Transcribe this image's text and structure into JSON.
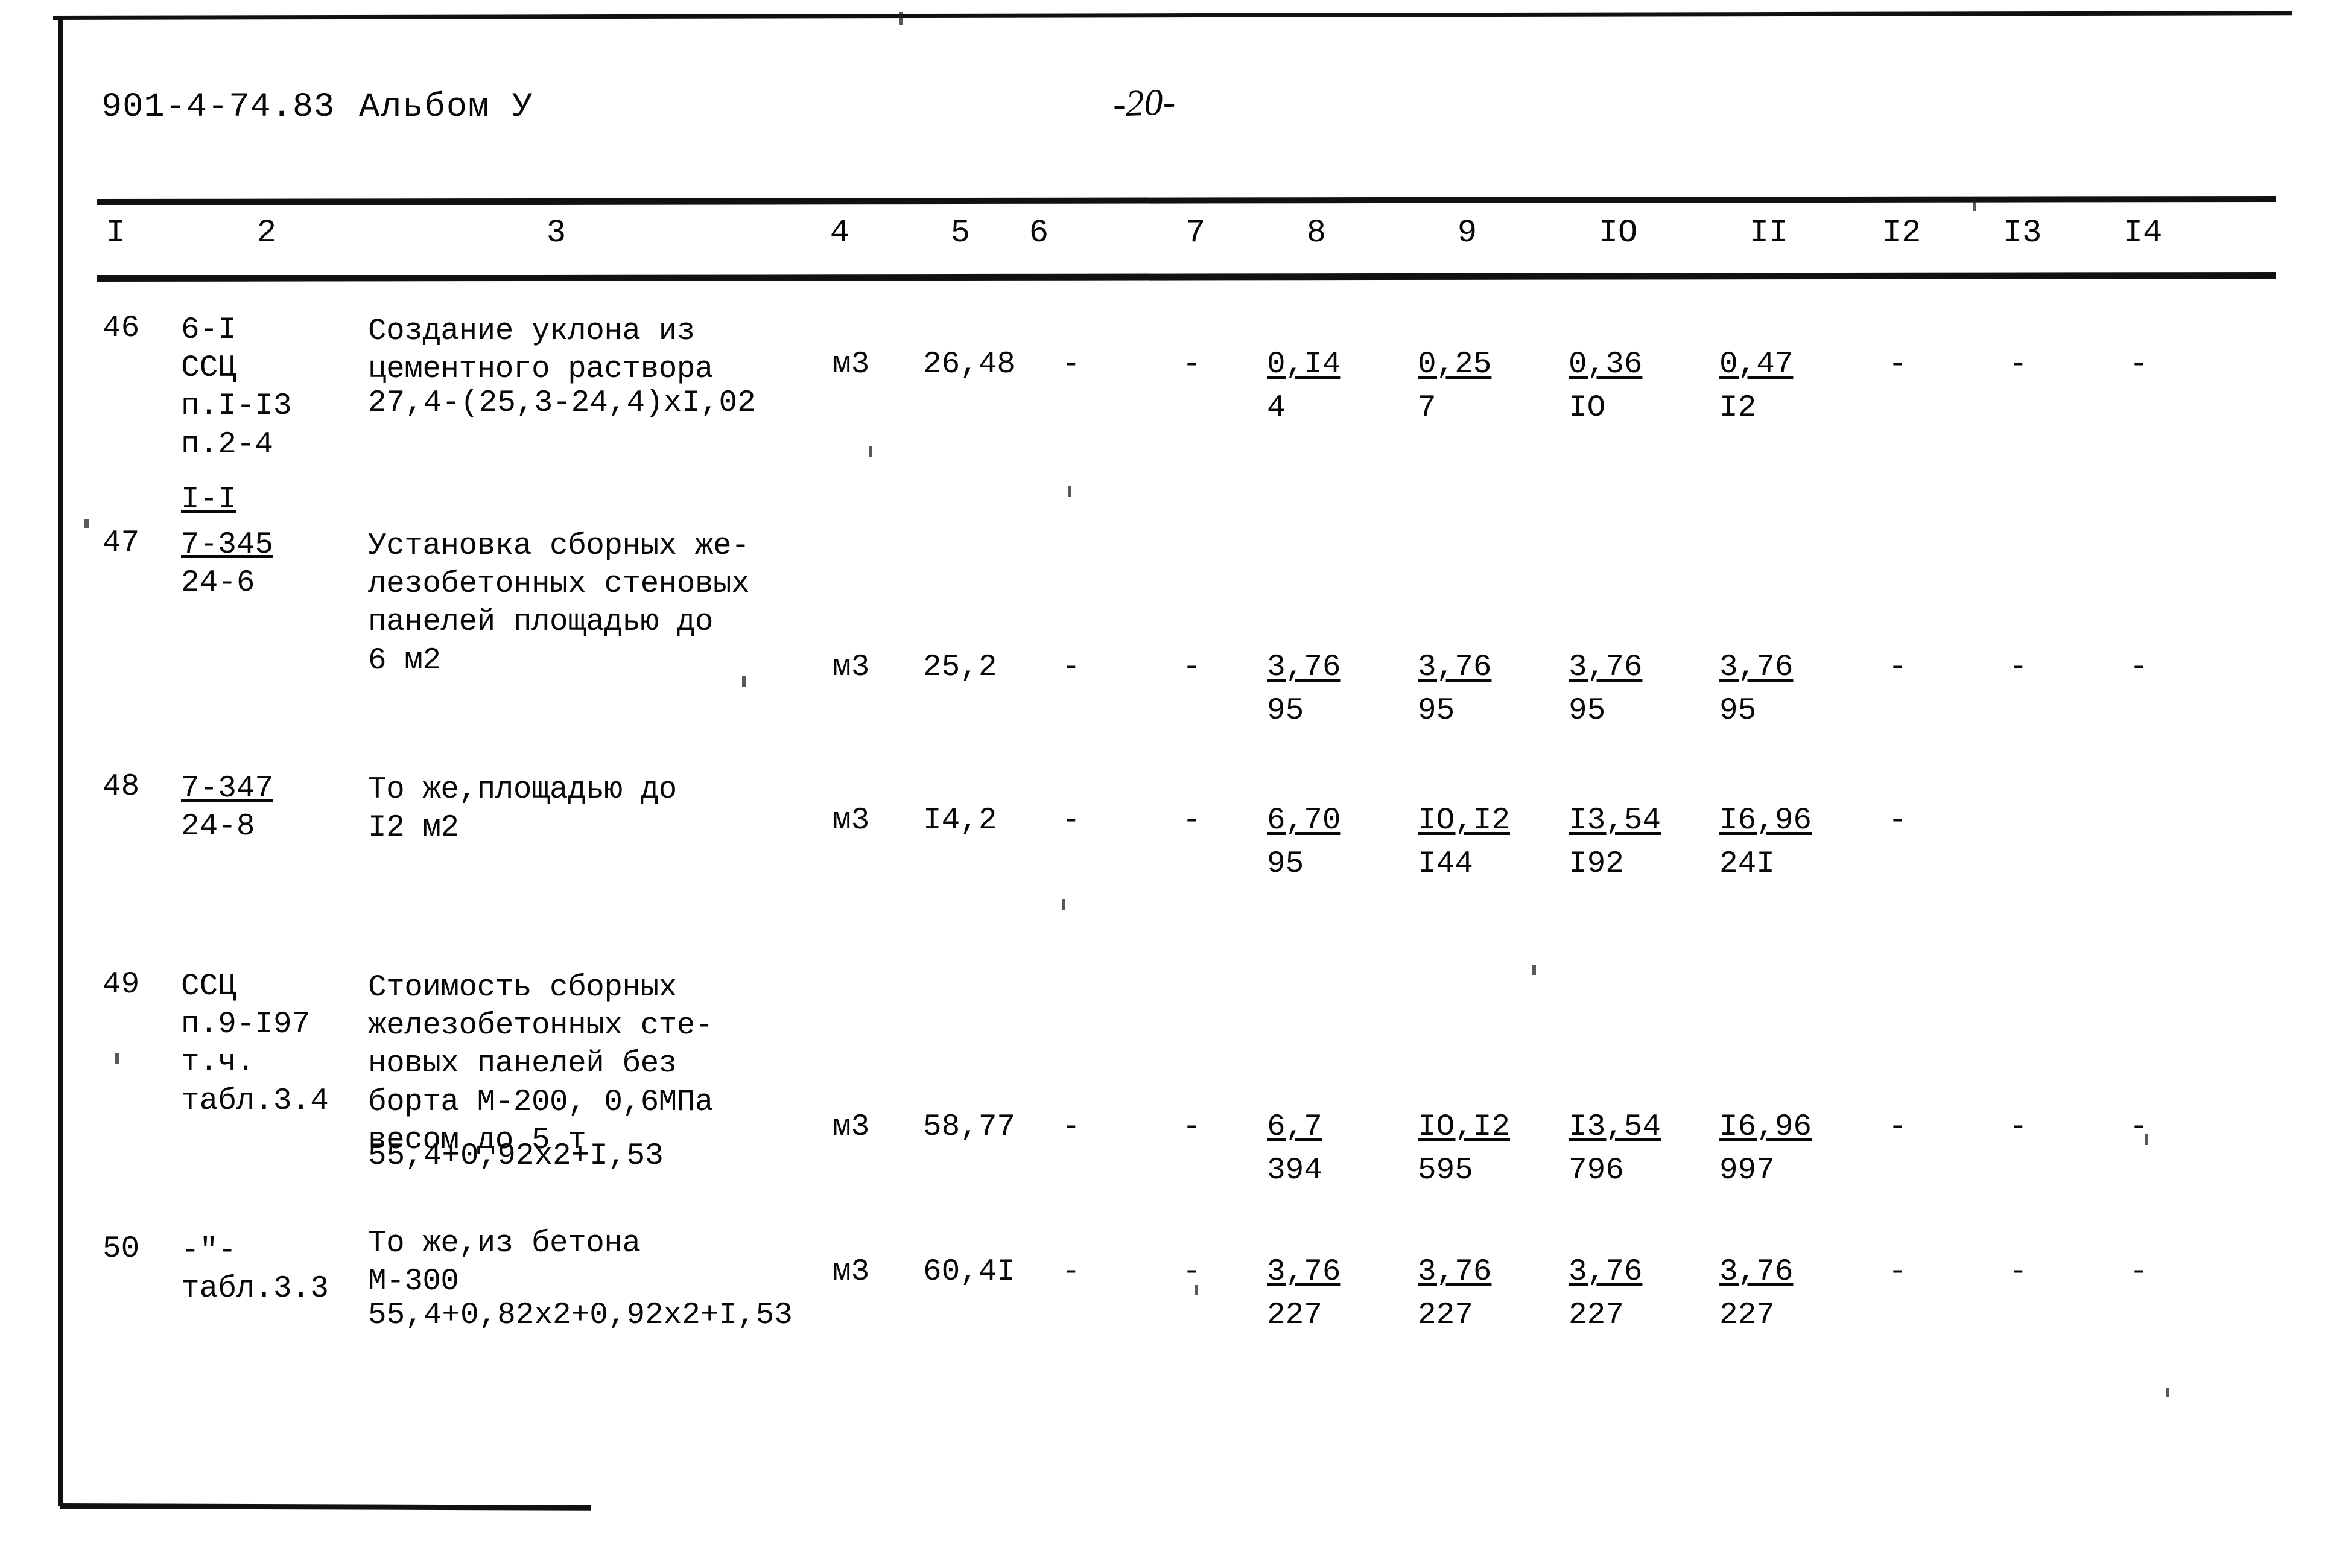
{
  "header": {
    "doc_code": "901-4-74.83",
    "album": "Альбом У",
    "page_number": "-20-"
  },
  "table": {
    "column_headers": [
      "I",
      "2",
      "3",
      "4",
      "5",
      "6",
      "7",
      "8",
      "9",
      "IO",
      "II",
      "I2",
      "I3",
      "I4"
    ],
    "rows": [
      {
        "num": "46",
        "code": "6-I\nССЦ\nп.I-I3\nп.2-4\nI-I",
        "code_underline_line": 4,
        "description": "Создание уклона из\nцементного раствора",
        "formula": "27,4-(25,3-24,4)xI,02",
        "unit": "м3",
        "qty": "26,48",
        "col6": "-",
        "col7": "-",
        "col8_top": "0,I4",
        "col8_bot": "4",
        "col9_top": "0,25",
        "col9_bot": "7",
        "col10_top": "0,36",
        "col10_bot": "IO",
        "col11_top": "0,47",
        "col11_bot": "I2",
        "col12": "-",
        "col13": "-",
        "col14": "-"
      },
      {
        "num": "47",
        "code": "7-345\n24-6",
        "code_underline_line": 0,
        "description": "Установка сборных же-\nлезобетонных стеновых\nпанелей площадью до\n6 м2",
        "formula": "",
        "unit": "м3",
        "qty": "25,2",
        "col6": "-",
        "col7": "-",
        "col8_top": "3,76",
        "col8_bot": "95",
        "col9_top": "3,76",
        "col9_bot": "95",
        "col10_top": "3,76",
        "col10_bot": "95",
        "col11_top": "3,76",
        "col11_bot": "95",
        "col12": "-",
        "col13": "-",
        "col14": "-"
      },
      {
        "num": "48",
        "code": "7-347\n24-8",
        "code_underline_line": 0,
        "description": "То же,площадью до\nI2 м2",
        "formula": "",
        "unit": "м3",
        "qty": "I4,2",
        "col6": "-",
        "col7": "-",
        "col8_top": "6,70",
        "col8_bot": "95",
        "col9_top": "IO,I2",
        "col9_bot": "I44",
        "col10_top": "I3,54",
        "col10_bot": "I92",
        "col11_top": "I6,96",
        "col11_bot": "24I",
        "col12": "-",
        "col13": "",
        "col14": ""
      },
      {
        "num": "49",
        "code": "ССЦ\nп.9-I97\nт.ч.\nтабл.3.4",
        "code_underline_line": -1,
        "description": "Стоимость сборных\nжелезобетонных сте-\nновых панелей без\nборта М-200, 0,6МПа\nвесом до 5 т",
        "formula": "55,4+0,92x2+I,53",
        "unit": "м3",
        "qty": "58,77",
        "col6": "-",
        "col7": "-",
        "col8_top": "6,7",
        "col8_bot": "394",
        "col9_top": "IO,I2",
        "col9_bot": "595",
        "col10_top": "I3,54",
        "col10_bot": "796",
        "col11_top": "I6,96",
        "col11_bot": "997",
        "col12": "-",
        "col13": "-",
        "col14": "-"
      },
      {
        "num": "50",
        "code": "-\"-\nтабл.3.3",
        "code_underline_line": -1,
        "description": "То же,из бетона\nМ-300",
        "formula": "55,4+0,82x2+0,92x2+I,53",
        "unit": "м3",
        "qty": "60,4I",
        "col6": "-",
        "col7": "-",
        "col8_top": "3,76",
        "col8_bot": "227",
        "col9_top": "3,76",
        "col9_bot": "227",
        "col10_top": "3,76",
        "col10_bot": "227",
        "col11_top": "3,76",
        "col11_bot": "227",
        "col12": "-",
        "col13": "-",
        "col14": "-"
      }
    ]
  }
}
